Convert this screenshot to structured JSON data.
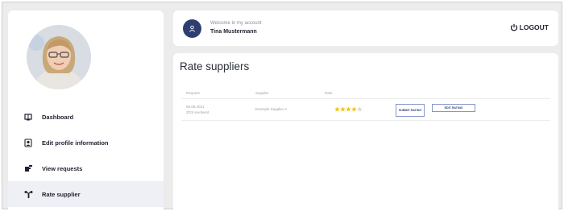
{
  "sidebar": {
    "items": [
      {
        "label": "Dashboard",
        "icon": "dashboard-icon"
      },
      {
        "label": "Edit profile information",
        "icon": "edit-profile-icon"
      },
      {
        "label": "View requests",
        "icon": "view-requests-icon"
      },
      {
        "label": "Rate supplier",
        "icon": "rate-supplier-icon",
        "active": true
      }
    ]
  },
  "header": {
    "welcome": "Welcome in my account",
    "username": "Tina Mustermann",
    "logout_label": "LOGOUT"
  },
  "main": {
    "title": "Rate suppliers",
    "columns": [
      "Request",
      "Supplier",
      "Rate"
    ],
    "rows": [
      {
        "date": "05.08.2021",
        "request_id": "ZGS involvent",
        "supplier": "Example Supplier A",
        "rating": 4,
        "rating_max": 5,
        "submit_label": "SUBMIT RATING",
        "edit_label": "EDIT RATING"
      }
    ]
  },
  "colors": {
    "accent": "#2f3e70",
    "star": "#f5c518",
    "star_empty": "#d9d9d9",
    "active_bg": "#eef0f6",
    "page_bg": "#ececec"
  }
}
